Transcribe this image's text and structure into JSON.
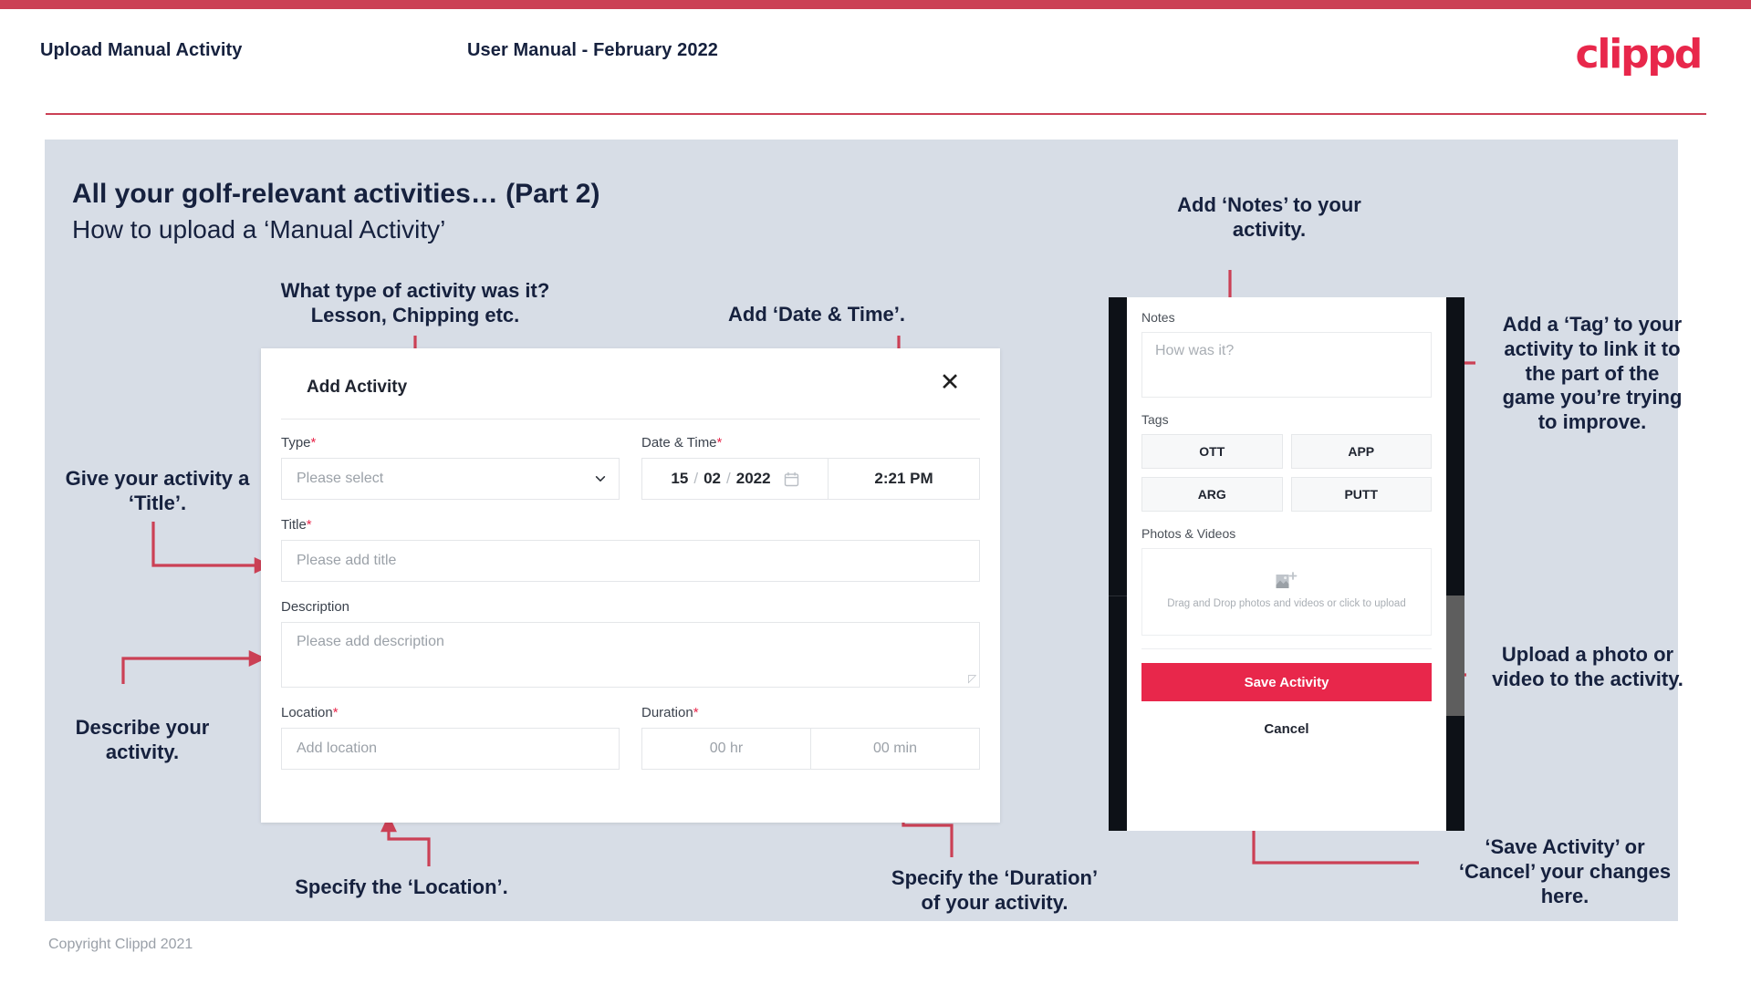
{
  "header": {
    "left_title": "Upload Manual Activity",
    "center_title": "User Manual - February 2022",
    "logo_text": "clippd"
  },
  "slide": {
    "title": "All your golf-relevant activities… (Part 2)",
    "subtitle": "How to upload a ‘Manual Activity’"
  },
  "footer": {
    "copyright": "Copyright Clippd 2021"
  },
  "annotations": {
    "type_note": "What type of activity was it?\nLesson, Chipping etc.",
    "datetime_note": "Add ‘Date & Time’.",
    "title_note": "Give your activity a\n‘Title’.",
    "description_note": "Describe your\nactivity.",
    "location_note": "Specify the ‘Location’.",
    "duration_note": "Specify the ‘Duration’\nof your activity.",
    "notes_note": "Add ‘Notes’ to your\nactivity.",
    "tag_note": "Add a ‘Tag’ to your\nactivity to link it to\nthe part of the\ngame you’re trying\nto improve.",
    "upload_note": "Upload a photo or\nvideo to the activity.",
    "save_note": "‘Save Activity’ or\n‘Cancel’ your changes\nhere."
  },
  "dialog": {
    "title": "Add Activity",
    "close_label": "✕",
    "fields": {
      "type_label": "Type",
      "type_required": "*",
      "type_placeholder": "Please select",
      "datetime_label": "Date & Time",
      "datetime_required": "*",
      "date_day": "15",
      "date_month": "02",
      "date_year": "2022",
      "time_value": "2:21 PM",
      "title_label": "Title",
      "title_required": "*",
      "title_placeholder": "Please add title",
      "description_label": "Description",
      "description_placeholder": "Please add description",
      "location_label": "Location",
      "location_required": "*",
      "location_placeholder": "Add location",
      "duration_label": "Duration",
      "duration_required": "*",
      "duration_hours_placeholder": "00 hr",
      "duration_minutes_placeholder": "00 min"
    }
  },
  "phone": {
    "notes_label": "Notes",
    "notes_placeholder": "How was it?",
    "tags_label": "Tags",
    "tags": [
      "OTT",
      "APP",
      "ARG",
      "PUTT"
    ],
    "photos_label": "Photos & Videos",
    "dropzone_text": "Drag and Drop photos and videos or click to upload",
    "save_button": "Save Activity",
    "cancel_button": "Cancel"
  },
  "colors": {
    "accent": "#e8274b",
    "rule": "#cb4055",
    "slide_bg": "#d7dde6",
    "ink": "#16213e"
  }
}
